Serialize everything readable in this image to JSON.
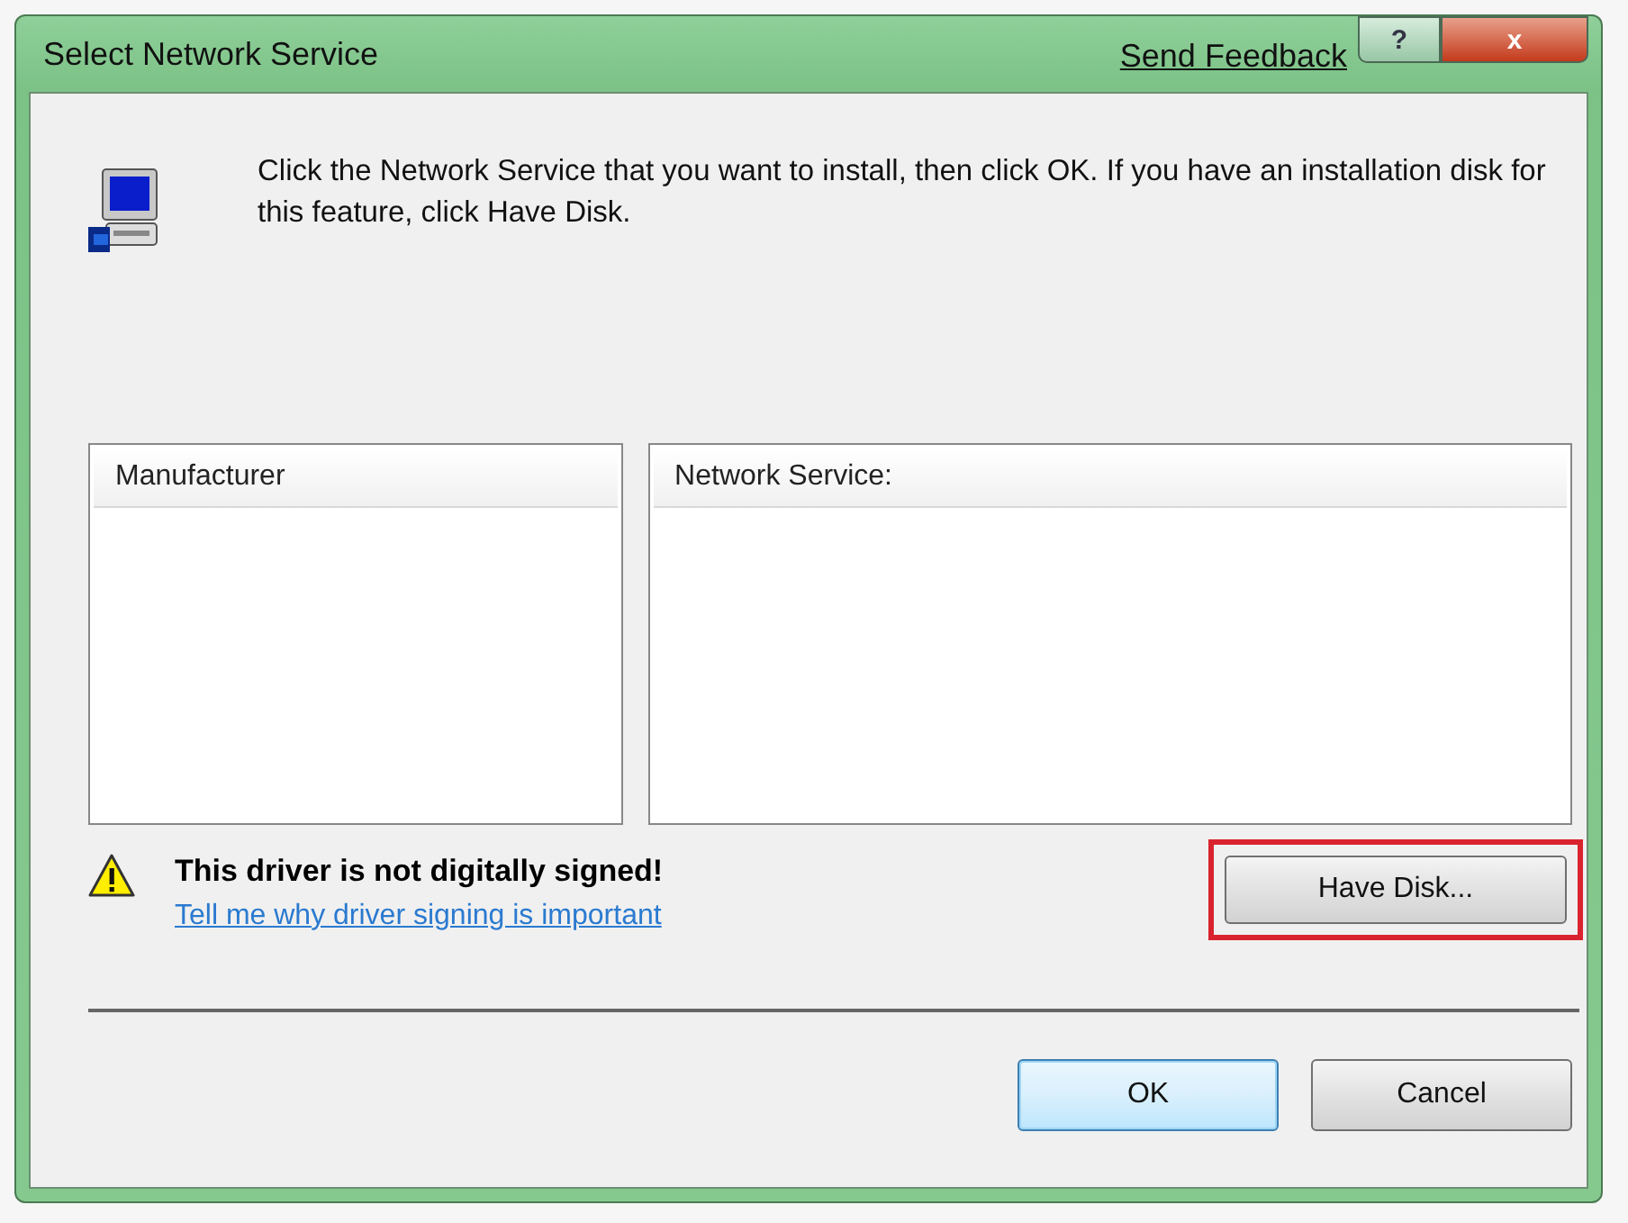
{
  "window": {
    "title": "Select Network Service",
    "feedback_link": "Send Feedback",
    "help_button": "?",
    "close_button": "x"
  },
  "instruction": "Click the Network Service that you want to install, then click OK. If you have an installation disk for this feature, click Have Disk.",
  "lists": [
    {
      "header": "Manufacturer"
    },
    {
      "header": "Network Service:"
    }
  ],
  "warning": {
    "text": "This driver is not digitally signed!",
    "link": "Tell me why driver signing is important"
  },
  "have_disk_button": {
    "label": "Have Disk...",
    "highlighted": true
  },
  "buttons": [
    {
      "label": "OK",
      "default": true
    },
    {
      "label": "Cancel",
      "default": false
    }
  ]
}
